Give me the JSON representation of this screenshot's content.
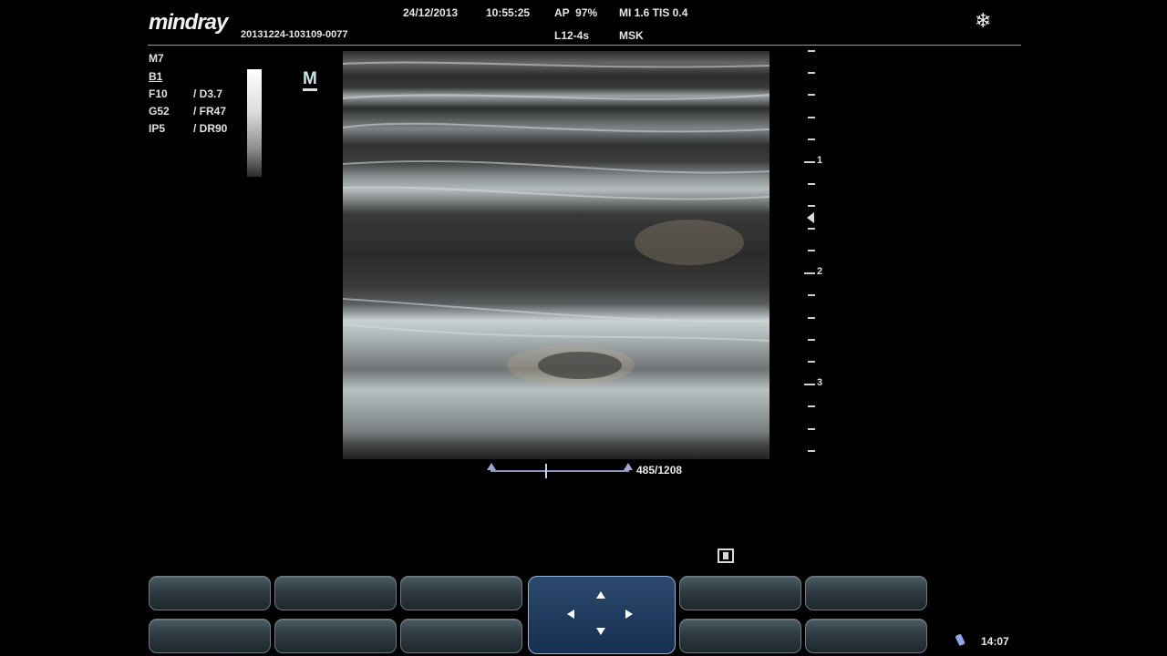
{
  "header": {
    "brand": "mindray",
    "exam_id": "20131224-103109-0077",
    "date": "24/12/2013",
    "time": "10:55:25",
    "ap": "AP  97%",
    "mi_tis": "MI 1.6 TIS 0.4",
    "probe": "L12-4s",
    "preset": "MSK",
    "freeze_icon": "snowflake-icon"
  },
  "params": {
    "mode": "M7",
    "b_mode": "B1",
    "left": [
      "F10",
      "G52",
      "IP5"
    ],
    "right": [
      "/ D3.7",
      "/ FR47",
      "/ DR90"
    ]
  },
  "m_badge": "M",
  "depth_scale": {
    "labels": [
      "1",
      "2",
      "3"
    ]
  },
  "cine": {
    "frame_label": "485/1208",
    "position": 0.4
  },
  "status": {
    "clock": "14:07",
    "probe_icon": "probe-icon"
  },
  "icons": {
    "clip": "clip-icon"
  },
  "colors": {
    "nav_pad": "#1f3a5c",
    "cine": "#8d94c4"
  }
}
